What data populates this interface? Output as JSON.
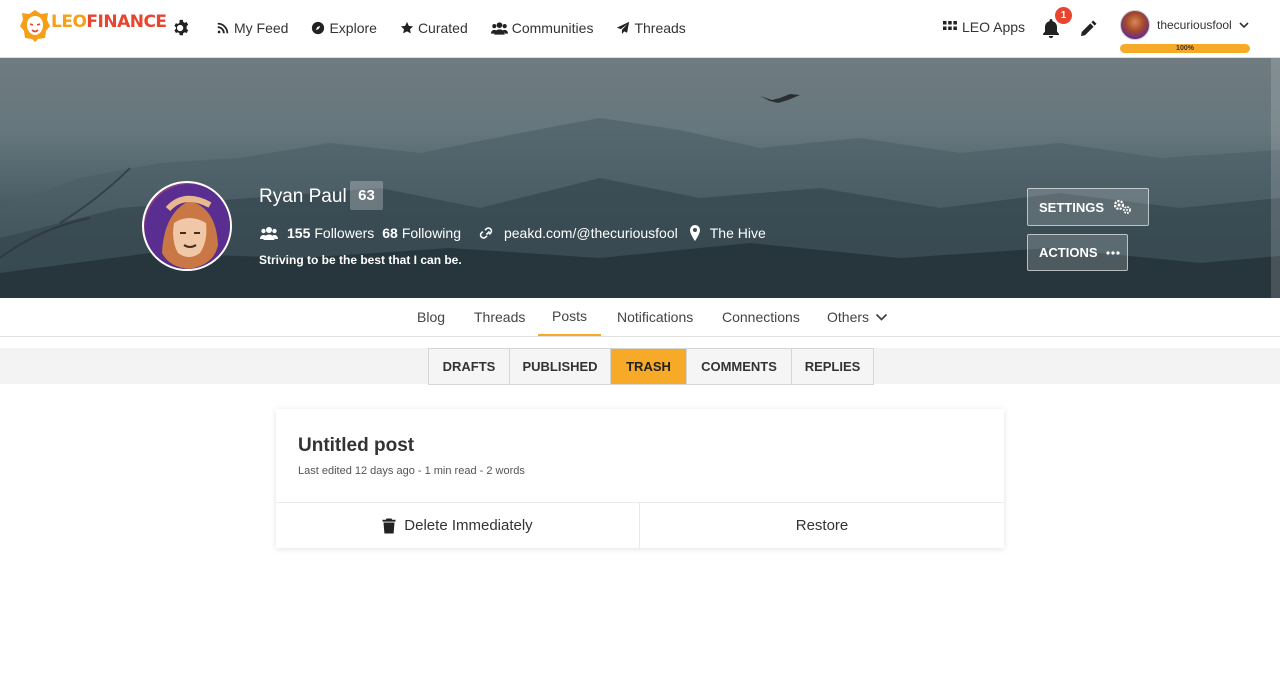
{
  "brand": {
    "leo": "LEO",
    "finance": "FINANCE"
  },
  "nav": {
    "items": [
      {
        "label": "My Feed",
        "icon": "rss-icon"
      },
      {
        "label": "Explore",
        "icon": "compass-icon"
      },
      {
        "label": "Curated",
        "icon": "star-icon"
      },
      {
        "label": "Communities",
        "icon": "users-icon"
      },
      {
        "label": "Threads",
        "icon": "paper-plane-icon"
      }
    ],
    "apps_label": "LEO Apps",
    "notification_count": "1",
    "username": "thecuriousfool",
    "voting_power": "100%"
  },
  "profile": {
    "name": "Ryan Paul",
    "reputation": "63",
    "followers_count": "155",
    "followers_label": "Followers",
    "following_count": "68",
    "following_label": "Following",
    "website": "peakd.com/@thecuriousfool",
    "location": "The Hive",
    "bio": "Striving to be the best that I can be.",
    "settings_label": "SETTINGS",
    "actions_label": "ACTIONS"
  },
  "tabs": {
    "blog": "Blog",
    "threads": "Threads",
    "posts": "Posts",
    "notifications": "Notifications",
    "connections": "Connections",
    "others": "Others"
  },
  "subtabs": {
    "drafts": "DRAFTS",
    "published": "PUBLISHED",
    "trash": "TRASH",
    "comments": "COMMENTS",
    "replies": "REPLIES"
  },
  "post": {
    "title": "Untitled post",
    "meta": "Last edited 12 days ago - 1 min read - 2 words",
    "delete_label": "Delete Immediately",
    "restore_label": "Restore"
  },
  "colors": {
    "accent": "#f7a928",
    "brand_orange": "#f6a01a",
    "brand_red": "#e8442e"
  }
}
